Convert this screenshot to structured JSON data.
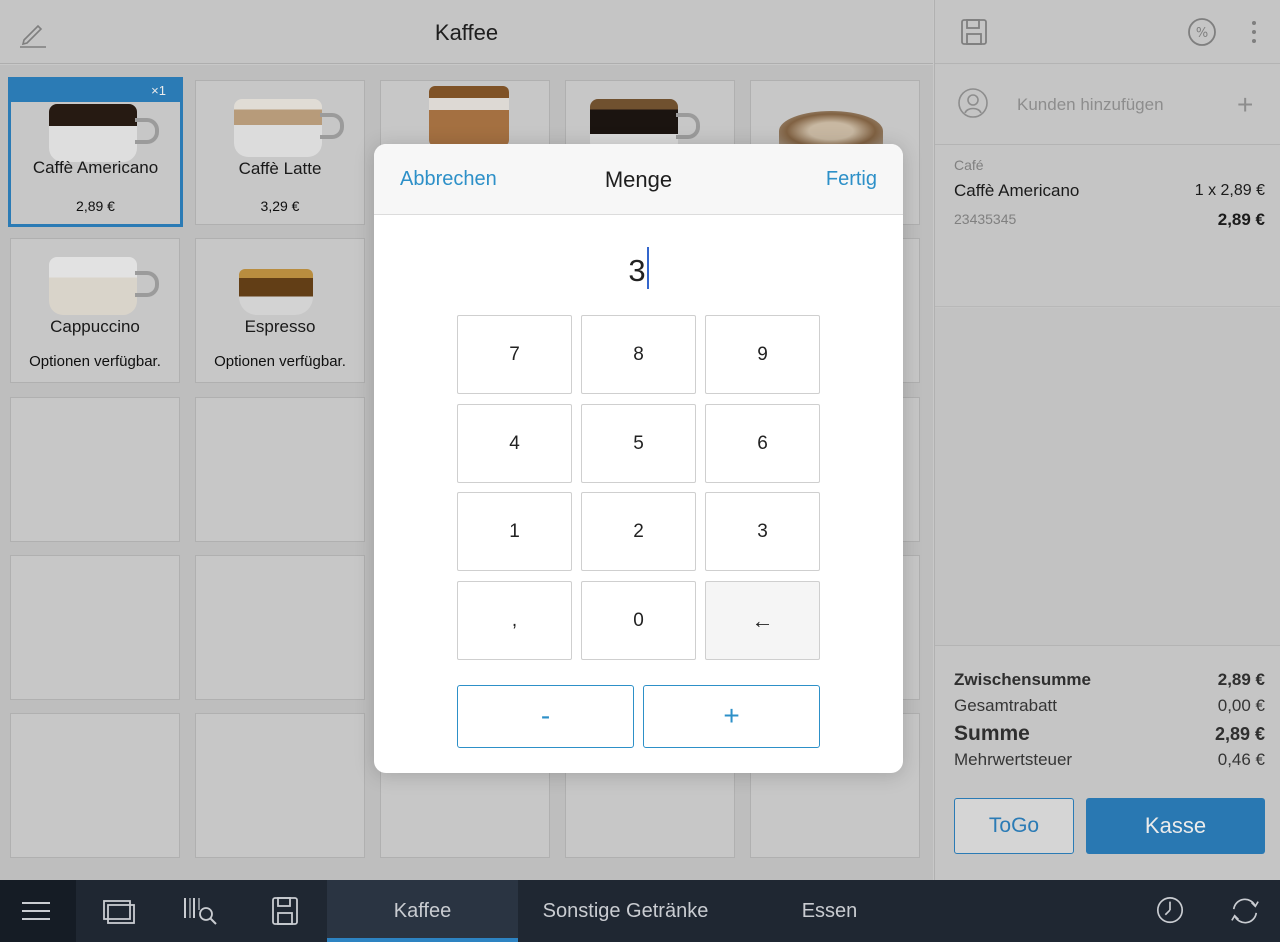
{
  "header": {
    "title": "Kaffee",
    "edit_icon": "pencil-icon"
  },
  "products": [
    {
      "name": "Caffè Americano",
      "price": "2,89 €",
      "badge": "×1",
      "selected": true
    },
    {
      "name": "Caffè Latte",
      "price": "3,29 €"
    },
    {
      "name": "Cappuccino",
      "options": "Optionen verfügbar."
    },
    {
      "name": "Espresso",
      "options": "Optionen verfügbar."
    }
  ],
  "cart": {
    "customer_placeholder": "Kunden hinzufügen",
    "category": "Café",
    "item_name": "Caffè Americano",
    "item_qty_price": "1 x 2,89 €",
    "item_sku": "23435345",
    "item_total": "2,89 €"
  },
  "totals": {
    "subtotal_label": "Zwischensumme",
    "subtotal": "2,89 €",
    "discount_label": "Gesamtrabatt",
    "discount": "0,00 €",
    "sum_label": "Summe",
    "sum": "2,89 €",
    "tax_label": "Mehrwertsteuer",
    "tax": "0,46 €"
  },
  "buttons": {
    "togo": "ToGo",
    "kasse": "Kasse"
  },
  "modal": {
    "cancel": "Abbrechen",
    "title": "Menge",
    "done": "Fertig",
    "value": "3",
    "keys": [
      "7",
      "8",
      "9",
      "4",
      "5",
      "6",
      "1",
      "2",
      "3",
      ",",
      "0",
      "←"
    ],
    "minus": "-",
    "plus": "+"
  },
  "bottom_tabs": [
    "Kaffee",
    "Sonstige Getränke",
    "Essen"
  ],
  "colors": {
    "accent": "#2d83c2",
    "bar": "#1f2732"
  }
}
